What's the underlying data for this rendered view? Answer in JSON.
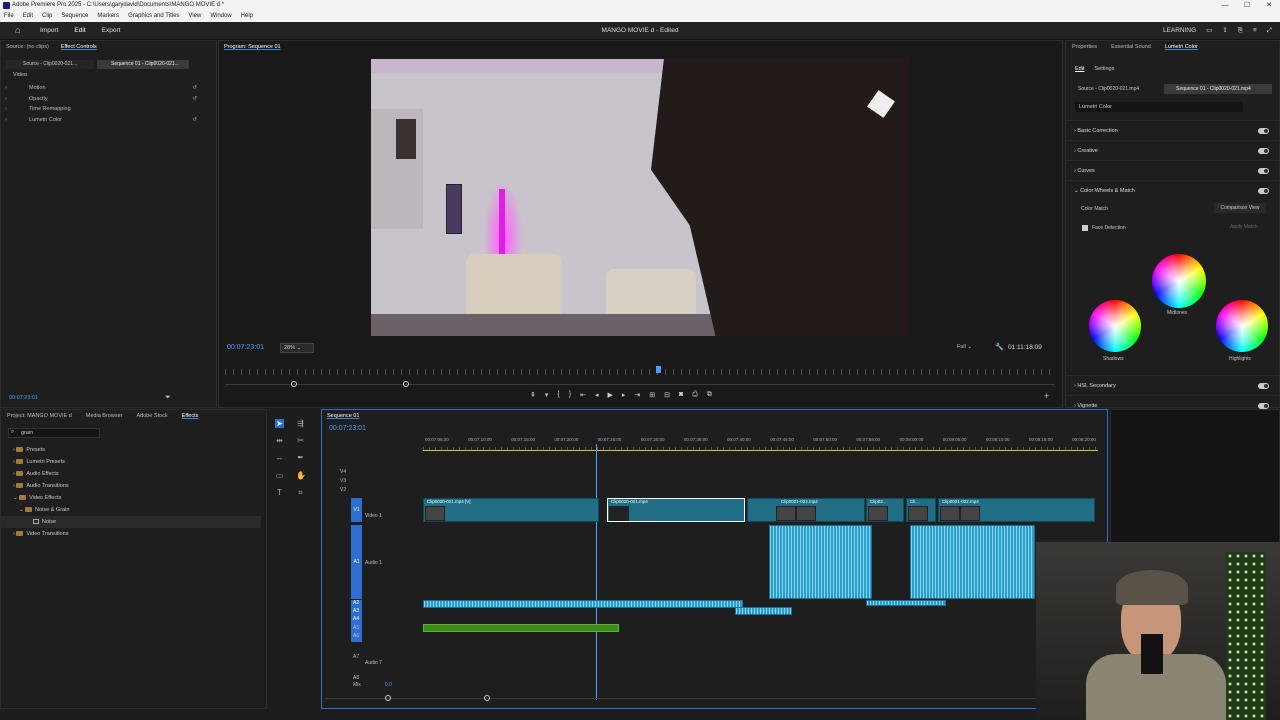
{
  "titlebar": {
    "title": "Adobe Premiere Pro 2025 - C:\\Users\\garydavid\\Documents\\MANGO MOVIE d *"
  },
  "menu": [
    "File",
    "Edit",
    "Clip",
    "Sequence",
    "Markers",
    "Graphics and Titles",
    "View",
    "Window",
    "Help"
  ],
  "workspace": {
    "tabs": [
      "Import",
      "Edit",
      "Export"
    ],
    "active": "Edit",
    "doc_title": "MANGO MOVIE d - Edited",
    "learning": "LEARNING"
  },
  "effect_controls": {
    "tabs": [
      "Source: (no clips)",
      "Effect Controls"
    ],
    "source_label": "Source - Clip0020-021...",
    "sequence_label": "Sequence 01 - Clip0020-021...",
    "video_label": "Video",
    "effects": [
      "Motion",
      "Opacity",
      "Time Remapping",
      "Lumetri Color"
    ],
    "timecode": "00:07:23:01"
  },
  "program": {
    "tab": "Program: Sequence 01",
    "timecode": "00:07:23:01",
    "zoom": "28%",
    "quality": "Full",
    "duration": "01:11:18:09"
  },
  "project": {
    "tabs": [
      "Project: MANGO MOVIE d",
      "Media Browser",
      "Adobe Stock",
      "Effects"
    ],
    "search": "grain",
    "tree": [
      "Presets",
      "Lumetri Presets",
      "Audio Effects",
      "Audio Transitions",
      "Video Effects",
      "Noise & Grain",
      "Noise",
      "Video Transitions"
    ]
  },
  "timeline": {
    "tab": "Sequence 01",
    "timecode": "00:07:23:01",
    "ruler": [
      "00:07:05:00",
      "00:07:10:00",
      "00:07:15:00",
      "00:07:20:00",
      "00:07:25:00",
      "00:07:30:00",
      "00:07:35:00",
      "00:07:40:00",
      "00:07:45:00",
      "00:07:50:00",
      "00:07:55:00",
      "00:08:00:00",
      "00:08:05:00",
      "00:08:10:00",
      "00:08:15:00",
      "00:08:20:00"
    ],
    "video_tracks": [
      "V4",
      "V3",
      "V2",
      "V1"
    ],
    "v1_name": "Video 1",
    "audio_tracks": [
      "A1",
      "A2",
      "A3",
      "A4",
      "A5",
      "A6",
      "A7",
      "A8"
    ],
    "a1_name": "Audio 1",
    "a7_name": "Audio 7",
    "mix": "Mix",
    "mix_value": "0.0",
    "clips": [
      "Clip0020-021.mp4 [V]",
      "Clip0020-021.mp4",
      "Clip0021-022.mp4",
      "Clip02...",
      "Cli...",
      "Clip0021-022.mp4"
    ]
  },
  "lumetri": {
    "tabs": [
      "Properties",
      "Essential Sound",
      "Lumetri Color"
    ],
    "subtabs": [
      "Edit",
      "Settings"
    ],
    "source_label": "Source - Clip0020-021.mp4",
    "sequence_label": "Sequence 01 - Clip0020-021.mp4",
    "dropdown": "Lumetri Color",
    "sections": [
      "Basic Correction",
      "Creative",
      "Curves",
      "Color Wheels & Match"
    ],
    "color_match": "Color Match",
    "comparison_view": "Comparison View",
    "face_detection": "Face Detection",
    "apply_match": "Apply Match",
    "midtones": "Midtones",
    "shadows": "Shadows",
    "highlights": "Highlights",
    "sections_bottom": [
      "HSL Secondary",
      "Vignette"
    ]
  }
}
